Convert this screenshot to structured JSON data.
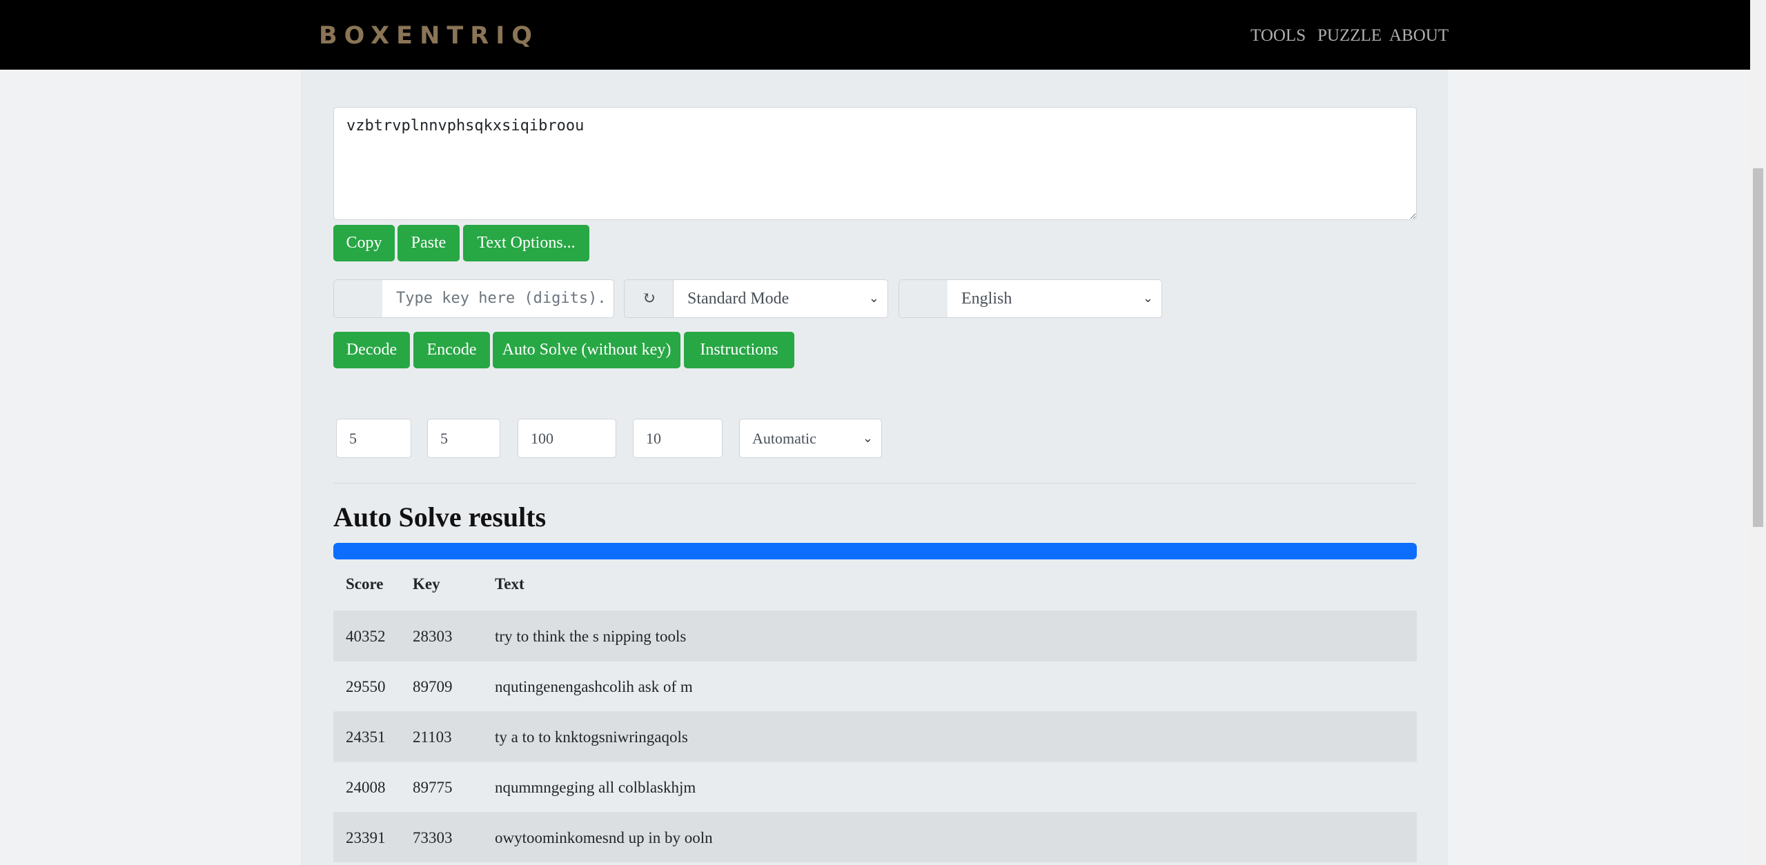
{
  "nav": {
    "brand": "BOXENTRIQ",
    "links": [
      "TOOLS",
      "PUZZLE",
      "ABOUT"
    ]
  },
  "editor": {
    "text": "vzbtrvplnnvphsqkxsiqibroou",
    "buttons": [
      "Copy",
      "Paste",
      "Text Options..."
    ]
  },
  "controls": {
    "key_placeholder": "Type key here (digits).",
    "reset_symbol": "↻",
    "mode": "Standard Mode",
    "language": "English"
  },
  "actions": [
    "Decode",
    "Encode",
    "Auto Solve (without key)",
    "Instructions"
  ],
  "params": {
    "p1": "5",
    "p2": "5",
    "p3": "100",
    "p4": "10",
    "method": "Automatic"
  },
  "results": {
    "title": "Auto Solve results",
    "progress_percent": 100,
    "headers": [
      "Score",
      "Key",
      "Text"
    ],
    "rows": [
      {
        "score": "40352",
        "key": "28303",
        "text": "try to think the s nipping tools"
      },
      {
        "score": "29550",
        "key": "89709",
        "text": "nqutingenengashcolih ask of m"
      },
      {
        "score": "24351",
        "key": "21103",
        "text": "ty a to to knktogsniwringaqols"
      },
      {
        "score": "24008",
        "key": "89775",
        "text": "nqummngeging all colblaskhjm"
      },
      {
        "score": "23391",
        "key": "73303",
        "text": "owytoominkomesnd up in by ooln"
      }
    ]
  },
  "colors": {
    "nav_bg": "#000000",
    "brand": "#8a7556",
    "button_green": "#28a745",
    "progress_blue": "#0d6efd"
  }
}
